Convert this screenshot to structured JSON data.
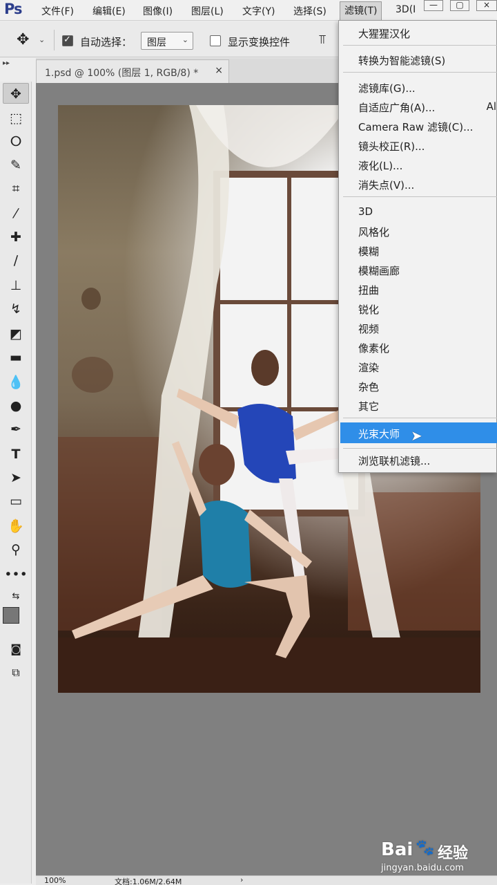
{
  "app": {
    "logo": "Ps"
  },
  "menubar": {
    "items": [
      "文件(F)",
      "编辑(E)",
      "图像(I)",
      "图层(L)",
      "文字(Y)",
      "选择(S)",
      "滤镜(T)",
      "3D(I"
    ]
  },
  "options": {
    "auto_select_label": "自动选择：",
    "auto_select_checked": true,
    "layer_select_value": "图层",
    "show_transform_label": "显示变换控件",
    "show_transform_checked": false
  },
  "tab": {
    "title": "1.psd @ 100% (图层 1, RGB/8) *",
    "close": "×"
  },
  "filter_menu": {
    "items": [
      "大猩猩汉化",
      "转换为智能滤镜(S)",
      "滤镜库(G)...",
      "自适应广角(A)...",
      "Camera Raw 滤镜(C)...",
      "镜头校正(R)...",
      "液化(L)...",
      "消失点(V)...",
      "3D",
      "风格化",
      "模糊",
      "模糊画廊",
      "扭曲",
      "锐化",
      "视频",
      "像素化",
      "渲染",
      "杂色",
      "其它",
      "光束大师",
      "浏览联机滤镜..."
    ],
    "highlighted": "光束大师",
    "shortcut_partial": "Al"
  },
  "status": {
    "zoom": "100%",
    "doc_info": "文档:1.06M/2.64M",
    "arrow": "›"
  },
  "watermark": {
    "brand": "Bai",
    "brand2": "经验",
    "url": "jingyan.baidu.com"
  },
  "colors": {
    "highlight": "#2f8ee8",
    "workspace": "#808080",
    "logo": "#2c3e8c"
  }
}
